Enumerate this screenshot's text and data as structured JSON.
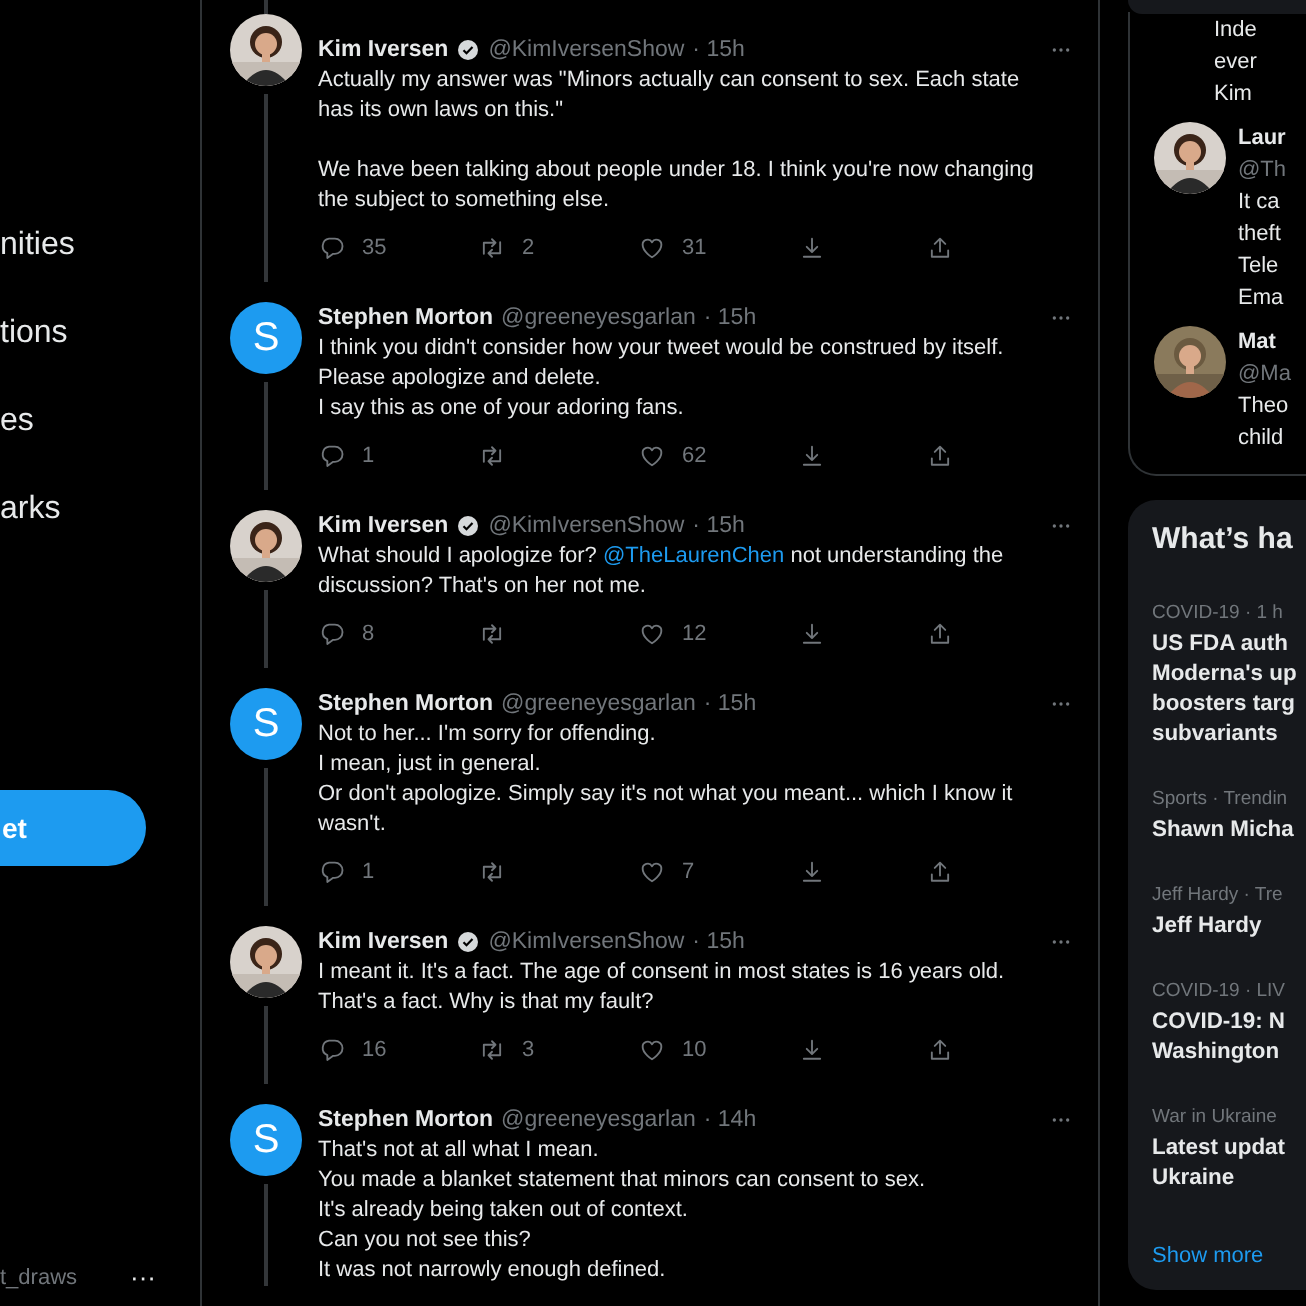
{
  "sidebar": {
    "nav_items": [
      "nities",
      "tions",
      "es",
      "arks"
    ],
    "tweet_button": "et",
    "account_handle": "t_draws",
    "more_button": "···"
  },
  "thread": [
    {
      "avatar": {
        "kind": "picture"
      },
      "name": "Kim Iversen",
      "verified": true,
      "handle": "@KimIversenShow",
      "time": "· 15h",
      "thread_line_above": true,
      "parts": [
        {
          "kind": "text",
          "text": "Actually my answer was \"Minors actually can consent to sex. Each state has its own laws on this.\"\n\nWe have been talking about people under 18. I think you're now changing the subject to something else."
        }
      ],
      "replies": "35",
      "retweets": "2",
      "likes": "31"
    },
    {
      "avatar": {
        "kind": "letter",
        "letter": "S"
      },
      "name": "Stephen Morton",
      "verified": false,
      "handle": "@greeneyesgarlan",
      "time": "· 15h",
      "thread_line_above": false,
      "parts": [
        {
          "kind": "text",
          "text": "I think you didn't consider how your tweet would be construed by itself.\nPlease apologize and delete.\nI say this as one of your adoring fans."
        }
      ],
      "replies": "1",
      "likes": "62"
    },
    {
      "avatar": {
        "kind": "picture"
      },
      "name": "Kim Iversen",
      "verified": true,
      "handle": "@KimIversenShow",
      "time": "· 15h",
      "thread_line_above": false,
      "parts": [
        {
          "kind": "text",
          "text": "What should I apologize for? "
        },
        {
          "kind": "mention",
          "text": "@TheLaurenChen"
        },
        {
          "kind": "text",
          "text": " not understanding the discussion? That's on her not me."
        }
      ],
      "replies": "8",
      "likes": "12"
    },
    {
      "avatar": {
        "kind": "letter",
        "letter": "S"
      },
      "name": "Stephen Morton",
      "verified": false,
      "handle": "@greeneyesgarlan",
      "time": "· 15h",
      "thread_line_above": false,
      "parts": [
        {
          "kind": "text",
          "text": "Not to her... I'm sorry for offending.\nI mean, just in general.\nOr don't apologize.  Simply say it's not what you meant... which I know it wasn't."
        }
      ],
      "replies": "1",
      "likes": "7"
    },
    {
      "avatar": {
        "kind": "picture"
      },
      "name": "Kim Iversen",
      "verified": true,
      "handle": "@KimIversenShow",
      "time": "· 15h",
      "thread_line_above": false,
      "parts": [
        {
          "kind": "text",
          "text": "I meant it. It's a fact. The age of consent in most states is 16 years old. That's a fact. Why is that my fault?"
        }
      ],
      "replies": "16",
      "retweets": "3",
      "likes": "10"
    },
    {
      "avatar": {
        "kind": "letter",
        "letter": "S"
      },
      "name": "Stephen Morton",
      "verified": false,
      "handle": "@greeneyesgarlan",
      "time": "· 14h",
      "thread_line_above": false,
      "parts": [
        {
          "kind": "text",
          "text": "That's not at all what I mean.\nYou made a blanket statement that minors can consent to sex.\nIt's already being taken out of context.\nCan you not see this?\nIt was not narrowly enough defined."
        }
      ]
    }
  ],
  "follow_card": {
    "items": [
      {
        "avatar": false,
        "lines": [
          "Inde",
          "ever",
          "Kim"
        ]
      },
      {
        "avatar": true,
        "name": "Laur",
        "handle": "@Th",
        "lines": [
          "It ca",
          "theft",
          "Tele",
          "Ema"
        ]
      },
      {
        "avatar": true,
        "name": "Mat",
        "handle": "@Ma",
        "lines": [
          "Theo",
          "child"
        ]
      }
    ]
  },
  "trends": {
    "title": "What’s ha",
    "items": [
      {
        "meta": "COVID-19 · 1 h",
        "lines": [
          "US FDA auth",
          "Moderna's up",
          "boosters targ",
          "subvariants"
        ]
      },
      {
        "meta": "Sports · Trendin",
        "lines": [
          "Shawn Micha"
        ]
      },
      {
        "meta": "Jeff Hardy · Tre",
        "lines": [
          "Jeff Hardy"
        ]
      },
      {
        "meta": "COVID-19 · LIV",
        "lines": [
          "COVID-19: N",
          "Washington"
        ]
      },
      {
        "meta": "War in Ukraine",
        "lines": [
          "Latest updat",
          "Ukraine"
        ]
      }
    ],
    "show_more": "Show more"
  }
}
